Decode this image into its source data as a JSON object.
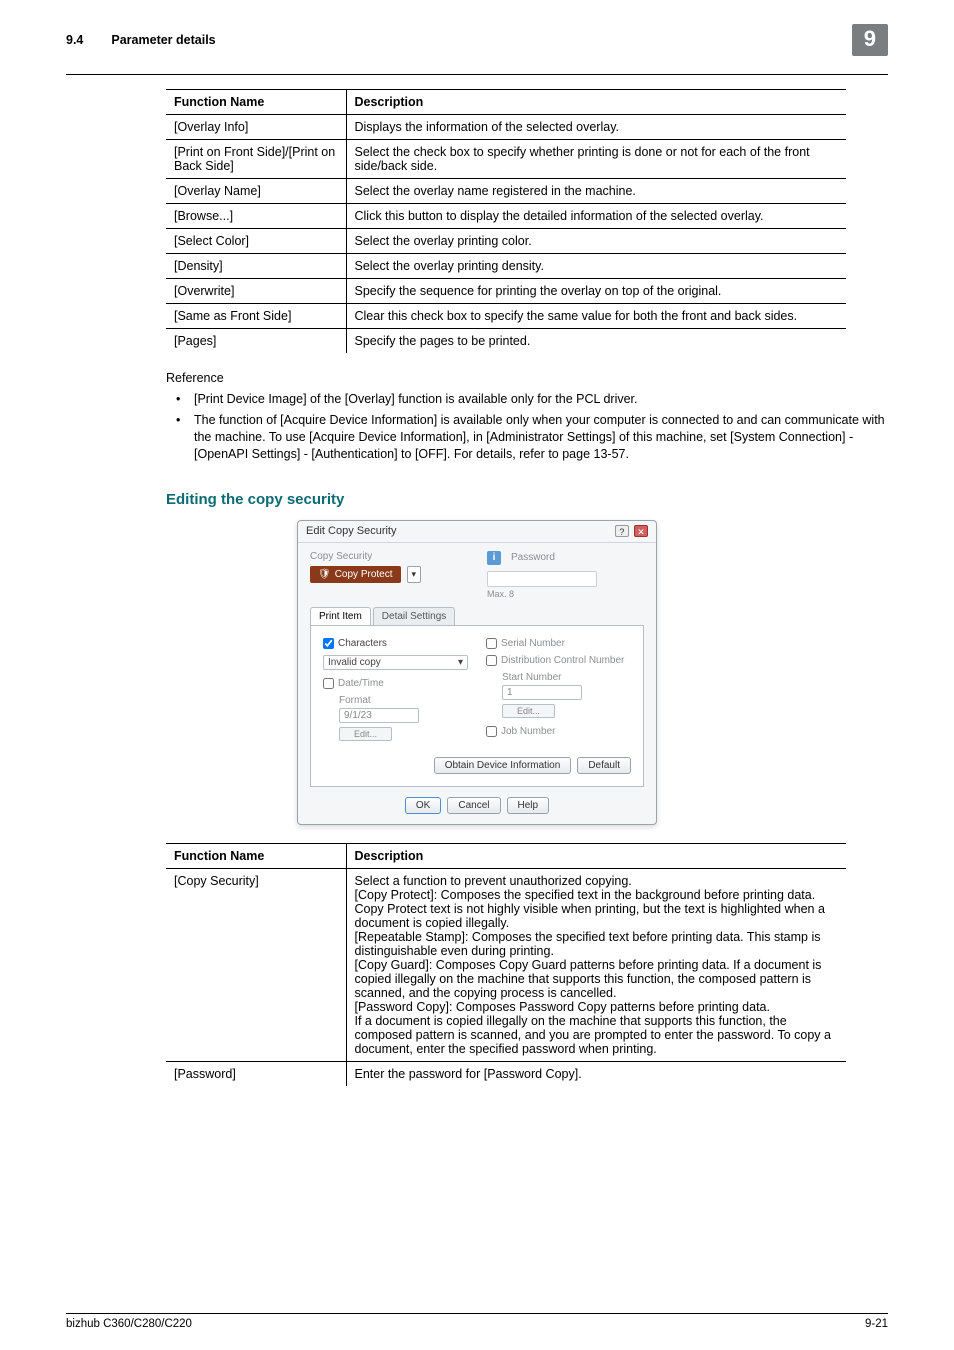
{
  "header": {
    "section_number": "9.4",
    "section_title": "Parameter details",
    "chapter_tab": "9"
  },
  "table1": {
    "head_func": "Function Name",
    "head_desc": "Description",
    "rows": [
      {
        "func": "[Overlay Info]",
        "desc": "Displays the information of the selected overlay."
      },
      {
        "func": "[Print on Front Side]/[Print on Back Side]",
        "desc": "Select the check box to specify whether printing is done or not for each of the front side/back side."
      },
      {
        "func": "[Overlay Name]",
        "desc": "Select the overlay name registered in the machine."
      },
      {
        "func": "[Browse...]",
        "desc": "Click this button to display the detailed information of the selected overlay."
      },
      {
        "func": "[Select Color]",
        "desc": "Select the overlay printing color."
      },
      {
        "func": "[Density]",
        "desc": "Select the overlay printing density."
      },
      {
        "func": "[Overwrite]",
        "desc": "Specify the sequence for printing the overlay on top of the original."
      },
      {
        "func": "[Same as Front Side]",
        "desc": "Clear this check box to specify the same value for both the front and back sides."
      },
      {
        "func": "[Pages]",
        "desc": "Specify the pages to be printed."
      }
    ]
  },
  "reference": {
    "label": "Reference",
    "items": [
      "[Print Device Image] of the [Overlay] function is available only for the PCL driver.",
      "The function of [Acquire Device Information] is available only when your computer is connected to and can communicate with the machine. To use [Acquire Device Information], in [Administrator Settings] of this machine, set [System Connection] - [OpenAPI Settings] - [Authentication] to [OFF]. For details, refer to page 13-57."
    ]
  },
  "subhead": "Editing the copy security",
  "dialog": {
    "title": "Edit Copy Security",
    "copy_security_label": "Copy Security",
    "copy_protect": "Copy Protect",
    "password_label": "Password",
    "max_label": "Max. 8",
    "tabs": {
      "print_item": "Print Item",
      "detail_settings": "Detail Settings"
    },
    "left": {
      "characters_label": "Characters",
      "characters_select": "Invalid copy",
      "datetime_label": "Date/Time",
      "format_label": "Format",
      "format_value": "9/1/23",
      "edit_btn": "Edit..."
    },
    "right": {
      "serial_label": "Serial Number",
      "dist_label": "Distribution Control Number",
      "start_label": "Start Number",
      "start_value": "1",
      "edit_btn": "Edit...",
      "job_label": "Job Number"
    },
    "obtain_btn": "Obtain Device Information",
    "default_btn": "Default",
    "ok_btn": "OK",
    "cancel_btn": "Cancel",
    "help_btn": "Help"
  },
  "table2": {
    "head_func": "Function Name",
    "head_desc": "Description",
    "rows": [
      {
        "func": "[Copy Security]",
        "desc": "Select a function to prevent unauthorized copying.\n[Copy Protect]: Composes the specified text in the background before printing data. Copy Protect text is not highly visible when printing, but the text is highlighted when a document is copied illegally.\n[Repeatable Stamp]: Composes the specified text before printing data. This stamp is distinguishable even during printing.\n[Copy Guard]: Composes Copy Guard patterns before printing data. If a document is copied illegally on the machine that supports this function, the composed pattern is scanned, and the copying process is cancelled.\n[Password Copy]: Composes Password Copy patterns before printing data.\nIf a document is copied illegally on the machine that supports this function, the composed pattern is scanned, and you are prompted to enter the password. To copy a document, enter the specified password when printing."
      },
      {
        "func": "[Password]",
        "desc": "Enter the password for [Password Copy]."
      }
    ]
  },
  "footer": {
    "model": "bizhub C360/C280/C220",
    "page": "9-21"
  }
}
